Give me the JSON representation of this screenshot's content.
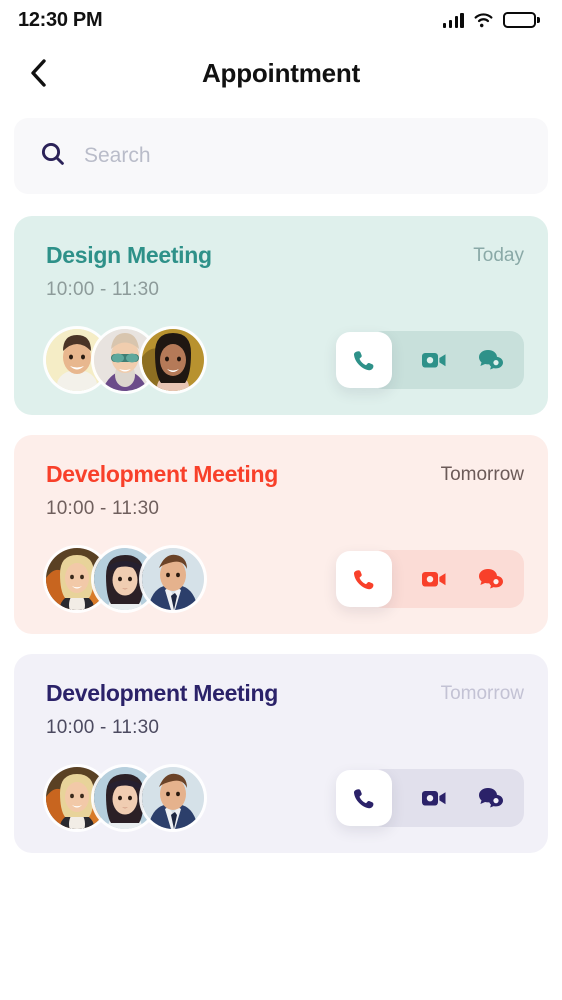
{
  "status_bar": {
    "time": "12:30 PM",
    "signal_icon": "cellular-signal-icon",
    "wifi_icon": "wifi-icon",
    "battery_icon": "battery-full-icon"
  },
  "header": {
    "back_icon": "chevron-left-icon",
    "title": "Appointment"
  },
  "search": {
    "icon": "search-icon",
    "placeholder": "Search",
    "value": ""
  },
  "colors": {
    "card1_bg": "#dff0ec",
    "card1_accent": "#2e9189",
    "card1_day": "#8aa9a7",
    "card1_time": "#8d9b9a",
    "card1_track": "#c8e0db",
    "card2_bg": "#fdeeea",
    "card2_accent": "#f8402a",
    "card2_day": "#6b5a58",
    "card2_time": "#6f5f5d",
    "card2_track": "#fbdcd6",
    "card3_bg": "#f2f1f8",
    "card3_accent": "#2b2269",
    "card3_day": "#c3c2d4",
    "card3_time": "#4c4a60",
    "card3_track": "#e1e0ec"
  },
  "appointments": [
    {
      "title": "Design Meeting",
      "day": "Today",
      "time": "10:00 - 11:30",
      "theme": "teal",
      "avatars": [
        "avatar-man-smiling",
        "avatar-person-sunglasses",
        "avatar-woman-dark-hair"
      ],
      "actions": {
        "call_icon": "phone-icon",
        "video_icon": "video-camera-icon",
        "chat_icon": "chat-bubbles-icon"
      }
    },
    {
      "title": "Development Meeting",
      "day": "Tomorrow",
      "time": "10:00 - 11:30",
      "theme": "red",
      "avatars": [
        "avatar-blonde-woman",
        "avatar-woman-headband",
        "avatar-man-suit"
      ],
      "actions": {
        "call_icon": "phone-icon",
        "video_icon": "video-camera-icon",
        "chat_icon": "chat-bubbles-icon"
      }
    },
    {
      "title": "Development Meeting",
      "day": "Tomorrow",
      "time": "10:00 - 11:30",
      "theme": "navy",
      "avatars": [
        "avatar-blonde-woman",
        "avatar-woman-headband",
        "avatar-man-suit"
      ],
      "actions": {
        "call_icon": "phone-icon",
        "video_icon": "video-camera-icon",
        "chat_icon": "chat-bubbles-icon"
      }
    }
  ]
}
